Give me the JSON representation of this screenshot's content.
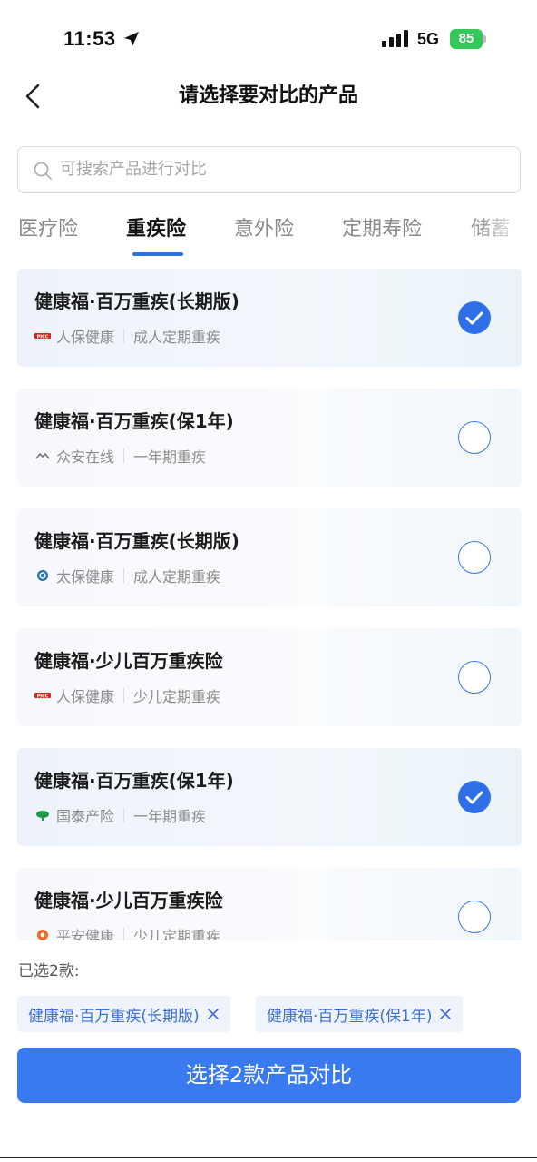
{
  "status_bar": {
    "time": "11:53",
    "network": "5G",
    "battery": "85",
    "icons": [
      "location-arrow-icon",
      "signal-bars-icon",
      "battery-charging-icon"
    ]
  },
  "nav": {
    "title": "请选择要对比的产品",
    "back_icon": "chevron-left-icon"
  },
  "search": {
    "placeholder": "可搜索产品进行对比",
    "value": ""
  },
  "tabs": [
    {
      "label": "医疗险",
      "active": false
    },
    {
      "label": "重疾险",
      "active": true
    },
    {
      "label": "意外险",
      "active": false
    },
    {
      "label": "定期寿险",
      "active": false
    },
    {
      "label": "储蓄",
      "active": false
    }
  ],
  "products": [
    {
      "name": "健康福·百万重疾(长期版)",
      "insurer": "人保健康",
      "insurer_icon": "picc-logo-icon",
      "category": "成人定期重疾",
      "selected": true
    },
    {
      "name": "健康福·百万重疾(保1年)",
      "insurer": "众安在线",
      "insurer_icon": "zhongan-logo-icon",
      "category": "一年期重疾",
      "selected": false
    },
    {
      "name": "健康福·百万重疾(长期版)",
      "insurer": "太保健康",
      "insurer_icon": "cpic-logo-icon",
      "category": "成人定期重疾",
      "selected": false
    },
    {
      "name": "健康福·少儿百万重疾险",
      "insurer": "人保健康",
      "insurer_icon": "picc-logo-icon",
      "category": "少儿定期重疾",
      "selected": false
    },
    {
      "name": "健康福·百万重疾(保1年)",
      "insurer": "国泰产险",
      "insurer_icon": "cathay-logo-icon",
      "category": "一年期重疾",
      "selected": true
    },
    {
      "name": "健康福·少儿百万重疾险",
      "insurer": "平安健康",
      "insurer_icon": "pingan-logo-icon",
      "category": "少儿定期重疾",
      "selected": false
    }
  ],
  "selection": {
    "label": "已选2款:",
    "chips": [
      {
        "label": "健康福·百万重疾(长期版)"
      },
      {
        "label": "健康福·百万重疾(保1年)"
      }
    ]
  },
  "compare_button": {
    "label": "选择2款产品对比"
  },
  "colors": {
    "accent": "#2f6fe8",
    "button": "#3a7af0",
    "chip_bg": "#eef3fc",
    "chip_text": "#3d6fd6",
    "battery": "#35c759"
  }
}
